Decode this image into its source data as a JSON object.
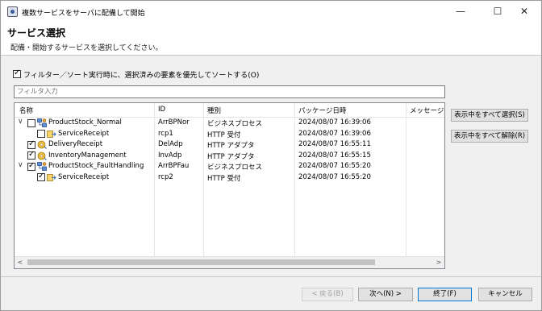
{
  "window": {
    "title": "複数サービスをサーバに配備して開始"
  },
  "header": {
    "title": "サービス選択",
    "description": "配備・開始するサービスを選択してください。"
  },
  "filter": {
    "checkbox_label": "フィルター／ソート実行時に、選択済みの要素を優先してソートする(O)",
    "checked": true,
    "input_placeholder": "フィルタ入力"
  },
  "table": {
    "columns": [
      "名称",
      "ID",
      "種別",
      "パッケージ日時",
      "メッセージ"
    ],
    "rows": [
      {
        "level": 0,
        "expand": "∨",
        "checked": false,
        "icon": "business-process-icon",
        "name": "ProductStock_Normal",
        "id": "ArrBPNor",
        "type": "ビジネスプロセス",
        "date": "2024/08/07 16:39:06",
        "message": ""
      },
      {
        "level": 1,
        "expand": "",
        "checked": false,
        "icon": "http-receiver-icon",
        "name": "ServiceReceipt",
        "id": "rcp1",
        "type": "HTTP 受付",
        "date": "2024/08/07 16:39:06",
        "message": ""
      },
      {
        "level": 0,
        "expand": "",
        "checked": true,
        "icon": "http-adapter-icon",
        "name": "DeliveryReceipt",
        "id": "DelAdp",
        "type": "HTTP アダプタ",
        "date": "2024/08/07 16:55:11",
        "message": ""
      },
      {
        "level": 0,
        "expand": "",
        "checked": true,
        "icon": "http-adapter-icon",
        "name": "InventoryManagement",
        "id": "InvAdp",
        "type": "HTTP アダプタ",
        "date": "2024/08/07 16:55:15",
        "message": ""
      },
      {
        "level": 0,
        "expand": "∨",
        "checked": true,
        "icon": "business-process-icon",
        "name": "ProductStock_FaultHandling",
        "id": "ArrBPFau",
        "type": "ビジネスプロセス",
        "date": "2024/08/07 16:55:20",
        "message": ""
      },
      {
        "level": 1,
        "expand": "",
        "checked": true,
        "icon": "http-receiver-icon",
        "name": "ServiceReceipt",
        "id": "rcp2",
        "type": "HTTP 受付",
        "date": "2024/08/07 16:55:20",
        "message": ""
      }
    ]
  },
  "side_buttons": {
    "select_all": "表示中をすべて選択(S)",
    "deselect_all": "表示中をすべて解除(R)"
  },
  "footer": {
    "back": "< 戻る(B)",
    "next": "次へ(N) >",
    "finish": "終了(F)",
    "cancel": "キャンセル"
  }
}
